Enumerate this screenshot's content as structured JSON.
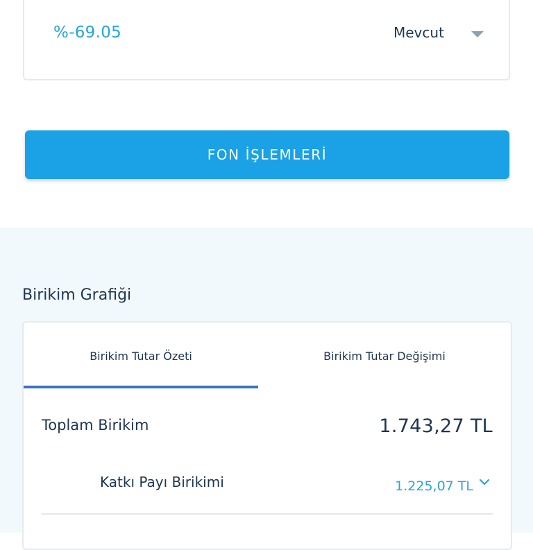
{
  "fund_card": {
    "percent": "%-69.05",
    "status_selected": "Mevcut",
    "dropdown_icon": "caret-down-icon"
  },
  "fon_button_label": "FON İŞLEMLERİ",
  "chart_section": {
    "title": "Birikim Grafiği",
    "tabs": [
      {
        "label": "Birikim Tutar Özeti",
        "active": true
      },
      {
        "label": "Birikim Tutar Değişimi",
        "active": false
      }
    ],
    "total": {
      "label": "Toplam Birikim",
      "value": "1.743,27 TL"
    },
    "contribution": {
      "label": "Katkı Payı Birikimi",
      "value": "1.225,07 TL",
      "icon": "chevron-down-icon"
    }
  },
  "colors": {
    "accent": "#1aa1e6",
    "value_blue": "#27a4db",
    "text_dark": "#1f3550",
    "tab_indicator": "#3b73c4",
    "section_bg": "#f2f9fc"
  }
}
